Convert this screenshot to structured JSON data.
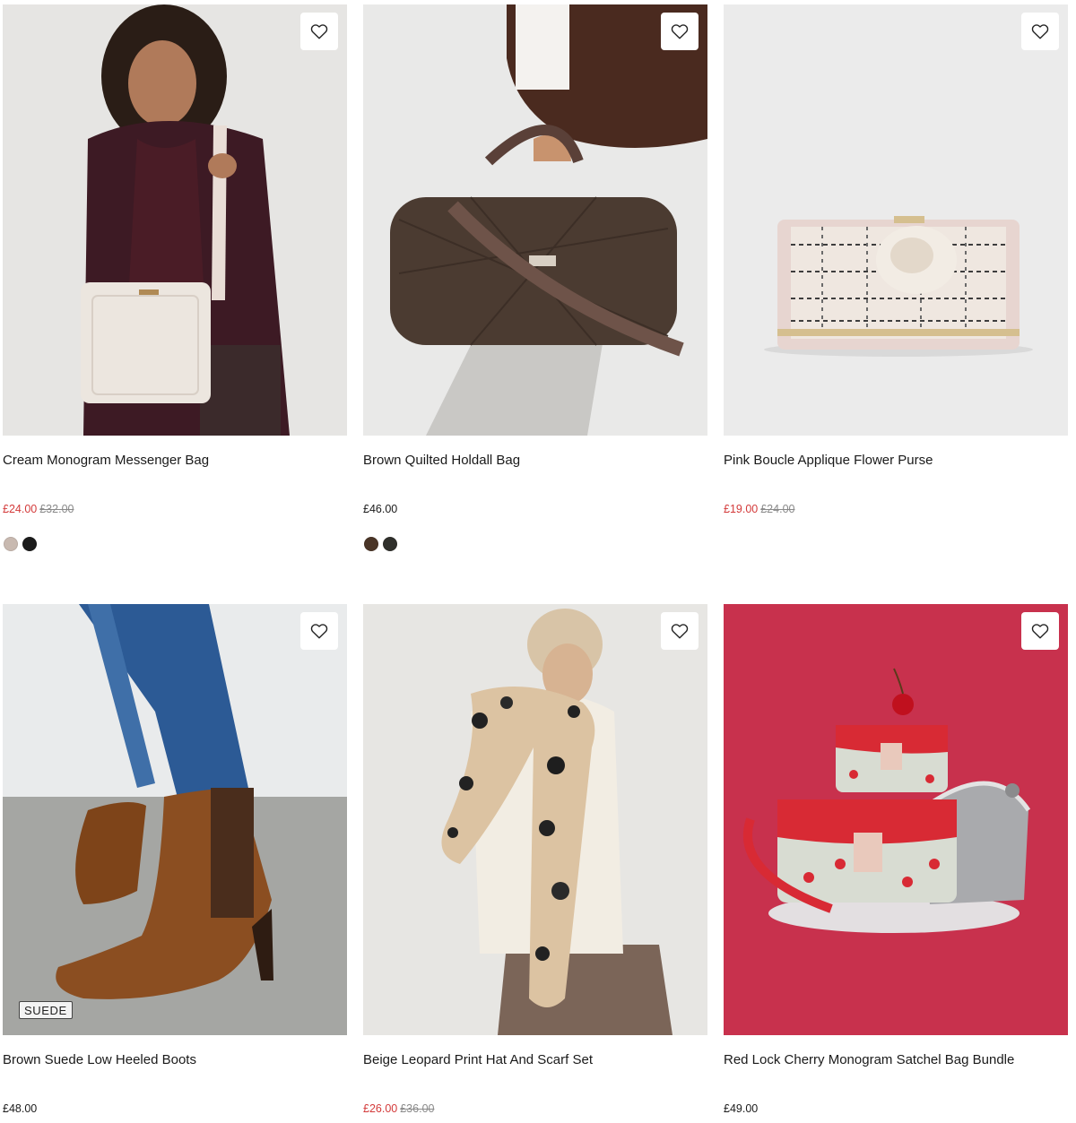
{
  "products": [
    {
      "name": "Cream Monogram Messenger Bag",
      "price": "£24.00",
      "was_price": "£32.00",
      "on_sale": true,
      "swatches": [
        "#c8b9b0",
        "#1b1b1b"
      ]
    },
    {
      "name": "Brown Quilted Holdall Bag",
      "price": "£46.00",
      "was_price": "",
      "on_sale": false,
      "swatches": [
        "#4a3527",
        "#2f2f2b"
      ]
    },
    {
      "name": "Pink Boucle Applique Flower Purse",
      "price": "£19.00",
      "was_price": "£24.00",
      "on_sale": true,
      "swatches": []
    },
    {
      "name": "Brown Suede Low Heeled Boots",
      "price": "£48.00",
      "was_price": "",
      "on_sale": false,
      "badge": "SUEDE",
      "swatches": []
    },
    {
      "name": "Beige Leopard Print Hat And Scarf Set",
      "price": "£26.00",
      "was_price": "£36.00",
      "on_sale": true,
      "swatches": []
    },
    {
      "name": "Red Lock Cherry Monogram Satchel Bag Bundle",
      "price": "£49.00",
      "was_price": "",
      "on_sale": false,
      "swatches": []
    }
  ],
  "colors": {
    "sale": "#d33a3a",
    "was": "#8a8a8a"
  },
  "icons": {
    "wishlist": "heart-outline-icon"
  }
}
